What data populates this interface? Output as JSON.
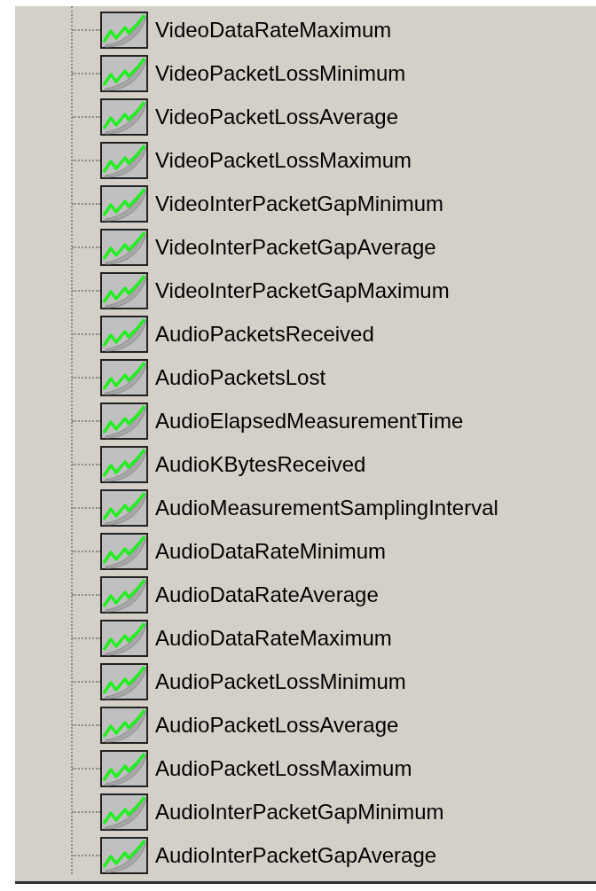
{
  "tree": {
    "items": [
      {
        "label": "VideoDataRateMaximum"
      },
      {
        "label": "VideoPacketLossMinimum"
      },
      {
        "label": "VideoPacketLossAverage"
      },
      {
        "label": "VideoPacketLossMaximum"
      },
      {
        "label": "VideoInterPacketGapMinimum"
      },
      {
        "label": "VideoInterPacketGapAverage"
      },
      {
        "label": "VideoInterPacketGapMaximum"
      },
      {
        "label": "AudioPacketsReceived"
      },
      {
        "label": "AudioPacketsLost"
      },
      {
        "label": "AudioElapsedMeasurementTime"
      },
      {
        "label": "AudioKBytesReceived"
      },
      {
        "label": "AudioMeasurementSamplingInterval"
      },
      {
        "label": "AudioDataRateMinimum"
      },
      {
        "label": "AudioDataRateAverage"
      },
      {
        "label": "AudioDataRateMaximum"
      },
      {
        "label": "AudioPacketLossMinimum"
      },
      {
        "label": "AudioPacketLossAverage"
      },
      {
        "label": "AudioPacketLossMaximum"
      },
      {
        "label": "AudioInterPacketGapMinimum"
      },
      {
        "label": "AudioInterPacketGapAverage"
      }
    ]
  }
}
